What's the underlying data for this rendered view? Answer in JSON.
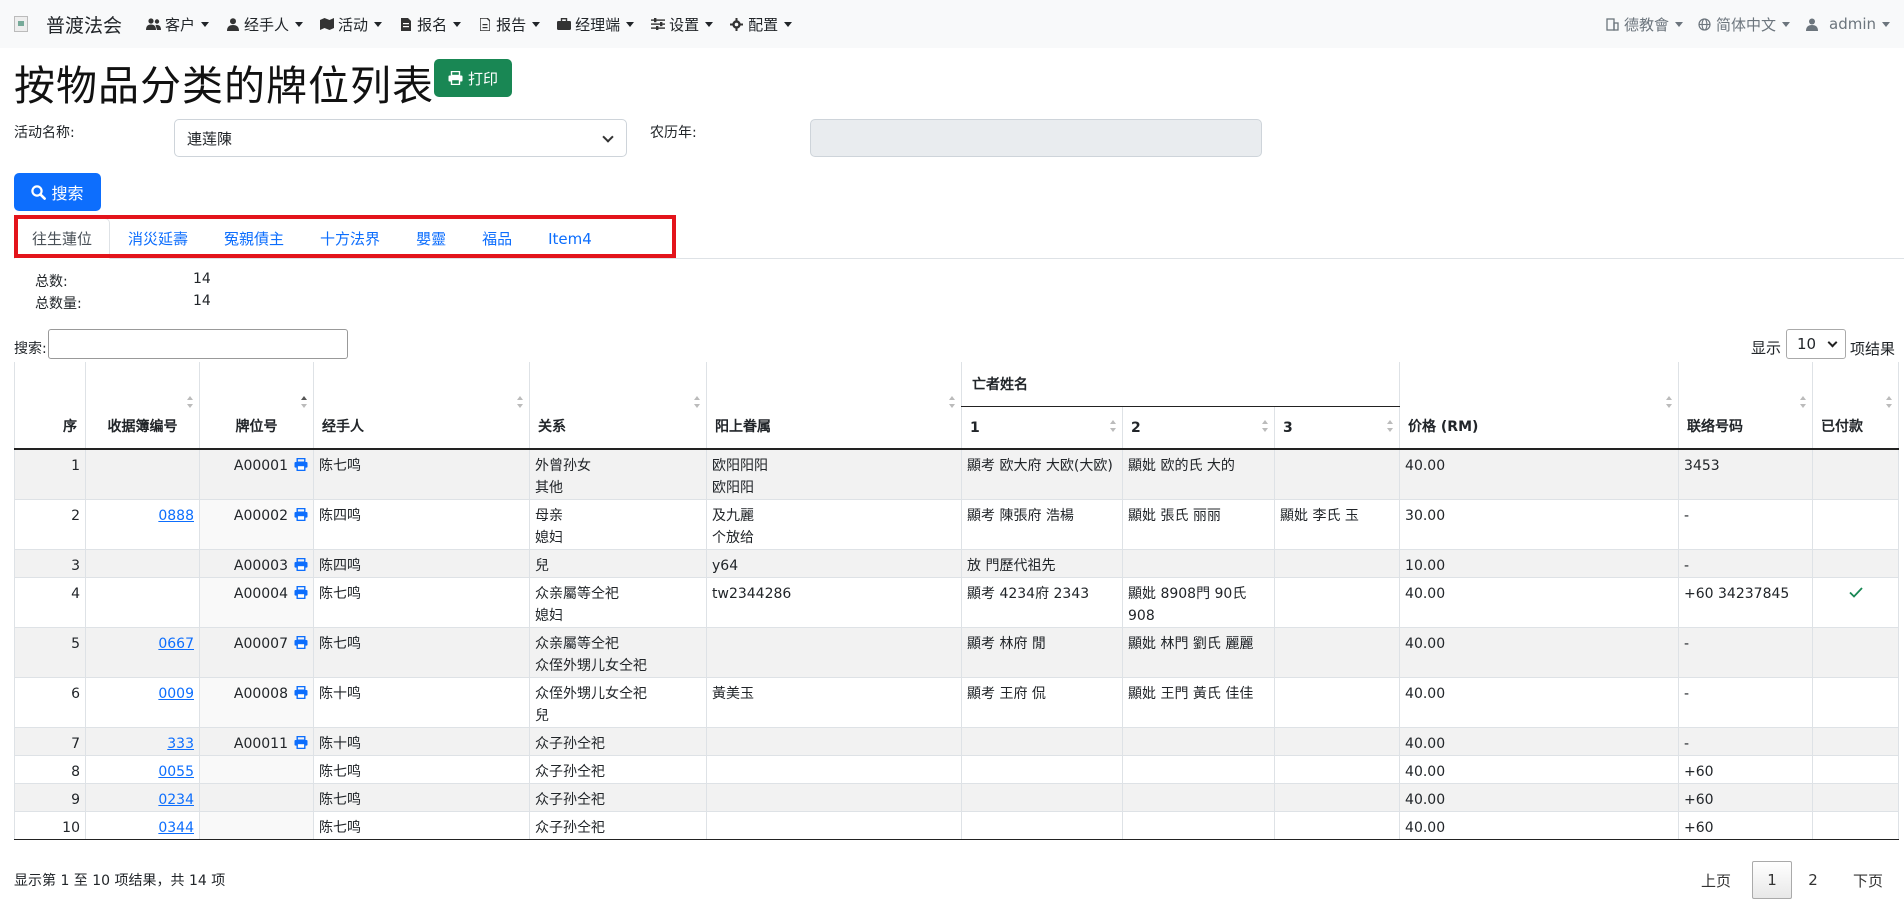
{
  "navbar": {
    "brand": "普渡法会",
    "items": [
      {
        "icon": "users-icon",
        "label": "客户"
      },
      {
        "icon": "user-tie-icon",
        "label": "经手人"
      },
      {
        "icon": "map-icon",
        "label": "活动"
      },
      {
        "icon": "file-icon",
        "label": "报名"
      },
      {
        "icon": "report-icon",
        "label": "报告"
      },
      {
        "icon": "briefcase-icon",
        "label": "经理端"
      },
      {
        "icon": "sliders-icon",
        "label": "设置"
      },
      {
        "icon": "gear-icon",
        "label": "配置"
      }
    ],
    "right": {
      "org": "德教會",
      "language": "简体中文",
      "user": "admin"
    }
  },
  "page": {
    "title": "按物品分类的牌位列表",
    "print_label": "打印"
  },
  "form": {
    "event_label": "活动名称:",
    "event_value": "連莲陳",
    "lunar_label": "农历年:",
    "lunar_value": "",
    "search_label": "搜索"
  },
  "tabs": [
    "往生蓮位",
    "消災延壽",
    "冤親債主",
    "十方法界",
    "嬰靈",
    "福品",
    "Item4"
  ],
  "active_tab": 0,
  "summary": {
    "total_label": "总数:",
    "total_value": "14",
    "qty_label": "总数量:",
    "qty_value": "14"
  },
  "table_controls": {
    "search_label": "搜索:",
    "show_label": "显示",
    "page_size": "10",
    "results_label": "项结果"
  },
  "table": {
    "headers": {
      "seq": "序",
      "receipt": "收据簿编号",
      "plaque": "牌位号",
      "handler": "经手人",
      "relation": "关系",
      "family": "阳上眷属",
      "deceased_group": "亡者姓名",
      "d1": "1",
      "d2": "2",
      "d3": "3",
      "price": "价格 (RM)",
      "phone": "联络号码",
      "paid": "已付款"
    },
    "rows": [
      {
        "seq": "1",
        "receipt": "",
        "plaque": "A00001",
        "handler": "陈七鸣",
        "relation": [
          "外曾孙女",
          "其他"
        ],
        "family": [
          "欧阳阳阳",
          "欧阳阳"
        ],
        "d1": "顯考 欧大府 大欧(大欧)",
        "d2": "顯妣 欧的氏 大的",
        "d3": "",
        "price": "40.00",
        "phone": "3453",
        "paid": false
      },
      {
        "seq": "2",
        "receipt": "0888",
        "plaque": "A00002",
        "handler": "陈四鸣",
        "relation": [
          "母亲",
          "媳妇"
        ],
        "family": [
          "及九麗",
          "个放给"
        ],
        "d1": "顯考 陳張府 浩楊",
        "d2": "顯妣 張氏 丽丽",
        "d3": "顯妣 李氏 玉",
        "price": "30.00",
        "phone": "-",
        "paid": false
      },
      {
        "seq": "3",
        "receipt": "",
        "plaque": "A00003",
        "handler": "陈四鸣",
        "relation": [
          "兒"
        ],
        "family": [
          "y64"
        ],
        "d1": "放 門歷代祖先",
        "d2": "",
        "d3": "",
        "price": "10.00",
        "phone": "-",
        "paid": false
      },
      {
        "seq": "4",
        "receipt": "",
        "plaque": "A00004",
        "handler": "陈七鸣",
        "relation": [
          "众亲屬等仝祀",
          "媳妇"
        ],
        "family": [
          "",
          "tw2344286"
        ],
        "d1": "顯考 4234府 2343",
        "d2": "顯妣 8908門 90氏 908",
        "d3": "",
        "price": "40.00",
        "phone": "+60 34237845",
        "paid": true
      },
      {
        "seq": "5",
        "receipt": "0667",
        "plaque": "A00007",
        "handler": "陈七鸣",
        "relation": [
          "众亲屬等仝祀",
          "众侄外甥儿女仝祀"
        ],
        "family": [
          ""
        ],
        "d1": "顯考 林府 閒",
        "d2": "顯妣 林門 劉氏 麗麗",
        "d3": "",
        "price": "40.00",
        "phone": "-",
        "paid": false
      },
      {
        "seq": "6",
        "receipt": "0009",
        "plaque": "A00008",
        "handler": "陈十鸣",
        "relation": [
          "众侄外甥儿女仝祀",
          "兒"
        ],
        "family": [
          "",
          "黃美玉"
        ],
        "d1": "顯考 王府 侃",
        "d2": "顯妣 王門 黃氏 佳佳",
        "d3": "",
        "price": "40.00",
        "phone": "-",
        "paid": false
      },
      {
        "seq": "7",
        "receipt": "333",
        "plaque": "A00011",
        "handler": "陈十鸣",
        "relation": [
          "众子孙仝祀"
        ],
        "family": [
          ""
        ],
        "d1": "",
        "d2": "",
        "d3": "",
        "price": "40.00",
        "phone": "-",
        "paid": false
      },
      {
        "seq": "8",
        "receipt": "0055",
        "plaque": "",
        "handler": "陈七鸣",
        "relation": [
          "众子孙仝祀"
        ],
        "family": [
          ""
        ],
        "d1": "",
        "d2": "",
        "d3": "",
        "price": "40.00",
        "phone": "+60",
        "paid": false
      },
      {
        "seq": "9",
        "receipt": "0234",
        "plaque": "",
        "handler": "陈七鸣",
        "relation": [
          "众子孙仝祀"
        ],
        "family": [
          ""
        ],
        "d1": "",
        "d2": "",
        "d3": "",
        "price": "40.00",
        "phone": "+60",
        "paid": false
      },
      {
        "seq": "10",
        "receipt": "0344",
        "plaque": "",
        "handler": "陈七鸣",
        "relation": [
          "众子孙仝祀"
        ],
        "family": [
          ""
        ],
        "d1": "",
        "d2": "",
        "d3": "",
        "price": "40.00",
        "phone": "+60",
        "paid": false
      }
    ]
  },
  "footer": {
    "info": "显示第 1 至 10 项结果，共 14 项",
    "prev": "上页",
    "pages": [
      "1",
      "2"
    ],
    "current_page": "1",
    "next": "下页"
  },
  "colors": {
    "primary": "#0d6efd",
    "success": "#198754",
    "highlight": "#e3141b",
    "paid_check": "#198754"
  }
}
